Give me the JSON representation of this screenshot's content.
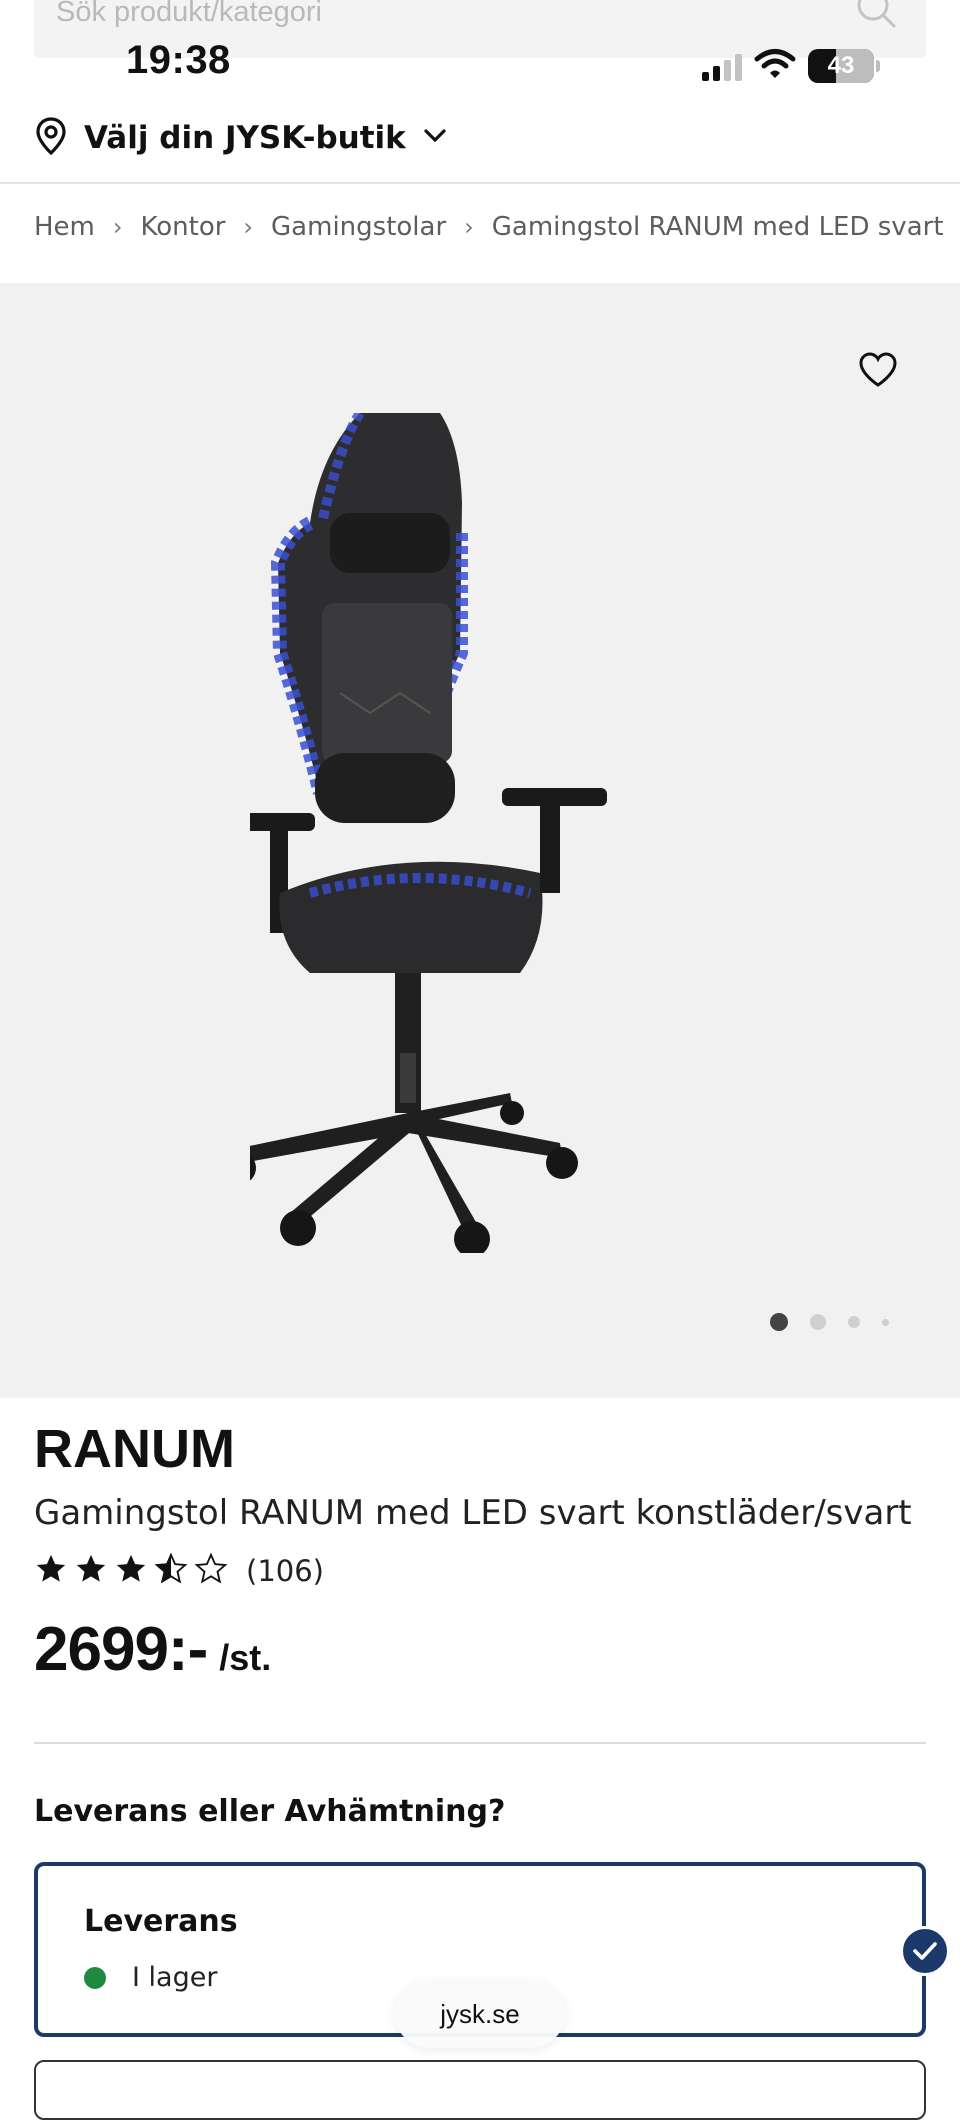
{
  "search": {
    "placeholder": "Sök produkt/kategori"
  },
  "status_bar": {
    "time": "19:38",
    "battery": "43",
    "battery_level": 0.43
  },
  "store": {
    "label": "Välj din JYSK-butik"
  },
  "breadcrumb": [
    "Hem",
    "Kontor",
    "Gamingstolar",
    "Gamingstol RANUM med LED svart"
  ],
  "gallery": {
    "image_count": 4,
    "active_index": 0
  },
  "product": {
    "brand": "RANUM",
    "name": "Gamingstol RANUM med LED svart konstläder/svart",
    "rating": 3.5,
    "rating_max": 5,
    "review_count": "(106)",
    "price": "2699:-",
    "unit": "/st."
  },
  "delivery": {
    "heading": "Leverans eller Avhämtning?",
    "option_title": "Leverans",
    "stock_status": "I lager",
    "stock_color": "#1f8a3f",
    "selected": true
  },
  "browser": {
    "url": "jysk.se"
  },
  "colors": {
    "accent": "#1b3a6b",
    "text": "#111111",
    "gallery_bg": "#f1f1f1"
  }
}
